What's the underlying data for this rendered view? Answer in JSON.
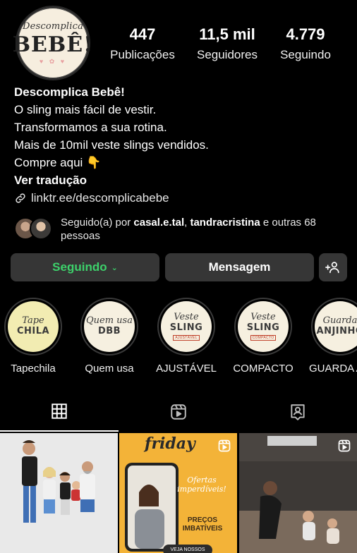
{
  "profile": {
    "avatar_line1": "Descomplica",
    "avatar_line2": "BEBÊ!",
    "stats": [
      {
        "value": "447",
        "label": "Publicações"
      },
      {
        "value": "11,5 mil",
        "label": "Seguidores"
      },
      {
        "value": "4.779",
        "label": "Seguindo"
      }
    ]
  },
  "bio": {
    "name": "Descomplica Bebê!",
    "lines": [
      "O sling mais fácil de vestir.",
      "Transformamos a sua rotina.",
      "Mais de 10mil veste slings vendidos.",
      "Compre aqui 👇"
    ],
    "translate": "Ver tradução",
    "link": "linktr.ee/descomplicabebe"
  },
  "followed_by": {
    "prefix": "Seguido(a) por ",
    "user1": "casal.e.tal",
    "sep": ", ",
    "user2": "tandracristina",
    "suffix": " e outras 68 pessoas"
  },
  "actions": {
    "following": "Seguindo",
    "message": "Mensagem",
    "add_user_icon": "add-user-icon"
  },
  "highlights": [
    {
      "title": "Tapechila",
      "line1": "Tape",
      "line2": "CHILA",
      "stamp": ""
    },
    {
      "title": "Quem usa",
      "line1": "Quem usa",
      "line2": "DBB",
      "stamp": ""
    },
    {
      "title": "AJUSTÁVEL",
      "line1": "Veste",
      "line2": "SLING",
      "stamp": "AJUSTÁVEL"
    },
    {
      "title": "COMPACTO",
      "line1": "Veste",
      "line2": "SLING",
      "stamp": "COMPACTO"
    },
    {
      "title": "GUARDA A",
      "line1": "Guarda",
      "line2": "ANJINHO",
      "stamp": ""
    }
  ],
  "tabs": [
    {
      "icon": "grid-icon"
    },
    {
      "icon": "reels-icon"
    },
    {
      "icon": "tagged-icon"
    }
  ],
  "posts": {
    "post2_title": "friday",
    "post2_offer": "Ofertas imperdíveis!",
    "post2_price": "PREÇOS IMBATÍVEIS",
    "post2_cta": "VEJA NOSSOS"
  },
  "colors": {
    "accent_green": "#3dd16b",
    "button_bg": "#363636"
  }
}
